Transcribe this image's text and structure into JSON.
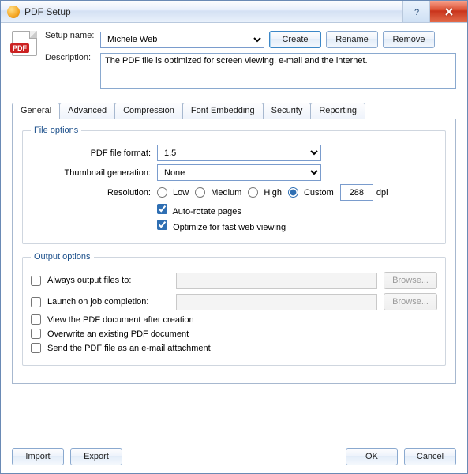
{
  "window": {
    "title": "PDF Setup"
  },
  "pdf_badge": "PDF",
  "setup": {
    "name_label": "Setup name:",
    "name_value": "Michele Web",
    "create": "Create",
    "rename": "Rename",
    "remove": "Remove",
    "desc_label": "Description:",
    "desc_value": "The PDF file is optimized for screen viewing, e-mail and the internet."
  },
  "tabs": {
    "general": "General",
    "advanced": "Advanced",
    "compression": "Compression",
    "font": "Font Embedding",
    "security": "Security",
    "reporting": "Reporting"
  },
  "file_options": {
    "legend": "File options",
    "format_label": "PDF file format:",
    "format_value": "1.5",
    "thumb_label": "Thumbnail generation:",
    "thumb_value": "None",
    "res_label": "Resolution:",
    "res_low": "Low",
    "res_med": "Medium",
    "res_high": "High",
    "res_custom": "Custom",
    "res_dpi": "288",
    "res_unit": "dpi",
    "autorotate": "Auto-rotate pages",
    "optimize": "Optimize for fast web viewing"
  },
  "output": {
    "legend": "Output options",
    "always": "Always output files to:",
    "launch": "Launch on job completion:",
    "browse": "Browse...",
    "view_after": "View the PDF document after creation",
    "overwrite": "Overwrite an existing PDF document",
    "send_email": "Send the PDF file as an e-mail attachment"
  },
  "footer": {
    "import": "Import",
    "export": "Export",
    "ok": "OK",
    "cancel": "Cancel"
  }
}
